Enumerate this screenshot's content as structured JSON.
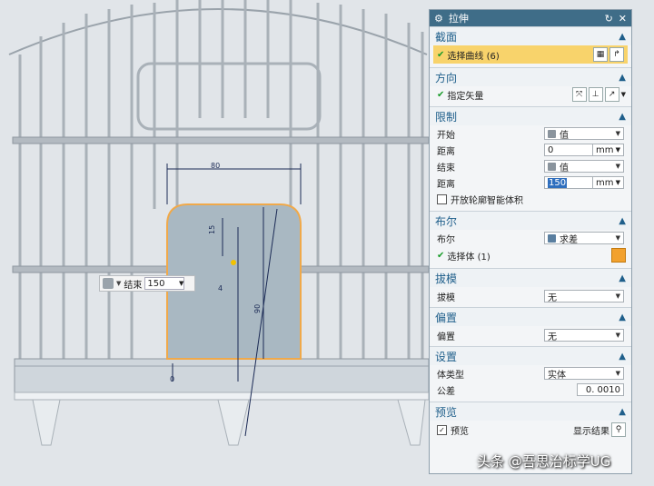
{
  "canvas": {
    "dim_top": "80",
    "dim_small": "15",
    "dim_side": "4",
    "dim_long": "90",
    "dim_bottom": "0"
  },
  "mini_toolbar": {
    "label": "结束",
    "value": "150"
  },
  "panel": {
    "title": "拉伸",
    "sections": {
      "section": {
        "header": "截面",
        "select_curve": "选择曲线 (6)"
      },
      "direction": {
        "header": "方向",
        "vector": "指定矢量"
      },
      "limits": {
        "header": "限制",
        "start_label": "开始",
        "start_value": "值",
        "start_dist_label": "距离",
        "start_dist": "0",
        "start_unit": "mm",
        "end_label": "结束",
        "end_value": "值",
        "end_dist_label": "距离",
        "end_dist": "150",
        "end_unit": "mm",
        "open_profile": "开放轮廓智能体积"
      },
      "boolean": {
        "header": "布尔",
        "label": "布尔",
        "value": "求差",
        "select_body": "选择体 (1)"
      },
      "draft": {
        "header": "拔模",
        "label": "拔模",
        "value": "无"
      },
      "offset": {
        "header": "偏置",
        "label": "偏置",
        "value": "无"
      },
      "settings": {
        "header": "设置",
        "body_type_label": "体类型",
        "body_type": "实体",
        "tolerance_label": "公差",
        "tolerance": "0. 0010"
      },
      "preview": {
        "header": "预览",
        "checkbox": "预览",
        "show_result": "显示结果"
      }
    }
  },
  "watermark": "头条 @吾思治标学UG",
  "colors": {
    "title_bg": "#3f6d88",
    "section_text": "#1f5f8b",
    "highlight": "#f8d36b",
    "profile_outline": "#f0a94a"
  }
}
